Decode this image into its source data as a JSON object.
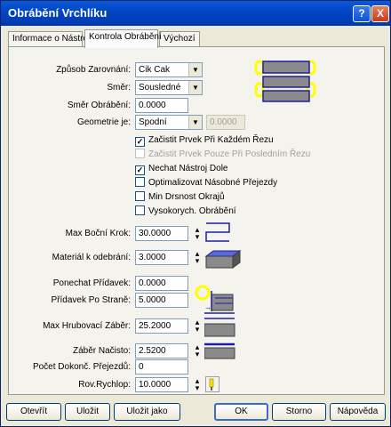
{
  "window": {
    "title": "Obrábění Vrchlíku",
    "help_btn": "?",
    "close_btn": "X"
  },
  "tabs": [
    {
      "label": "Informace o Nástroji"
    },
    {
      "label": "Kontrola Obrábění"
    },
    {
      "label": "Výchozí"
    }
  ],
  "form": {
    "zarovnani_label": "Způsob Zarovnání:",
    "zarovnani_value": "Cik Cak",
    "smer_label": "Směr:",
    "smer_value": "Sousledné",
    "smer_obrabeni_label": "Směr Obrábění:",
    "smer_obrabeni_value": "0.0000",
    "geometrie_label": "Geometrie je:",
    "geometrie_value": "Spodní",
    "geometrie_disabled_value": "0.0000"
  },
  "checkboxes": [
    {
      "label": "Začistit Prvek Při Každém Řezu",
      "checked": true,
      "disabled": false
    },
    {
      "label": "Začistit Prvek Pouze Při Posledním Řezu",
      "checked": false,
      "disabled": true
    },
    {
      "label": "Nechat Nástroj Dole",
      "checked": true,
      "disabled": false
    },
    {
      "label": "Optimalizovat Násobné Přejezdy",
      "checked": false,
      "disabled": false
    },
    {
      "label": "Min Drsnost Okrajů",
      "checked": false,
      "disabled": false
    },
    {
      "label": "Vysokorych. Obrábění",
      "checked": false,
      "disabled": false
    }
  ],
  "params": {
    "max_krok_label": "Max Boční Krok:",
    "max_krok_value": "30.0000",
    "material_label": "Materiál k odebrání:",
    "material_value": "3.0000",
    "ponechat_label": "Ponechat Přídavek:",
    "ponechat_value": "0.0000",
    "pridavek_strane_label": "Přídavek Po Straně:",
    "pridavek_strane_value": "5.0000",
    "max_zaber_label": "Max Hrubovací Záběr:",
    "max_zaber_value": "25.2000",
    "zaber_nacisto_label": "Záběr Načisto:",
    "zaber_nacisto_value": "2.5200",
    "pocet_label": "Počet Dokonč. Přejezdů:",
    "pocet_value": "0",
    "rychlop_label": "Rov.Rychlop:",
    "rychlop_value": "10.0000"
  },
  "buttons": {
    "open": "Otevřít",
    "save": "Uložit",
    "save_as": "Uložit jako",
    "ok": "OK",
    "cancel": "Storno",
    "help": "Nápověda"
  },
  "colors": {
    "accent": "#0a246a",
    "title_bar": "#0246c8",
    "diagram_blue": "#1c1ca8",
    "diagram_yellow": "#ffff00"
  }
}
